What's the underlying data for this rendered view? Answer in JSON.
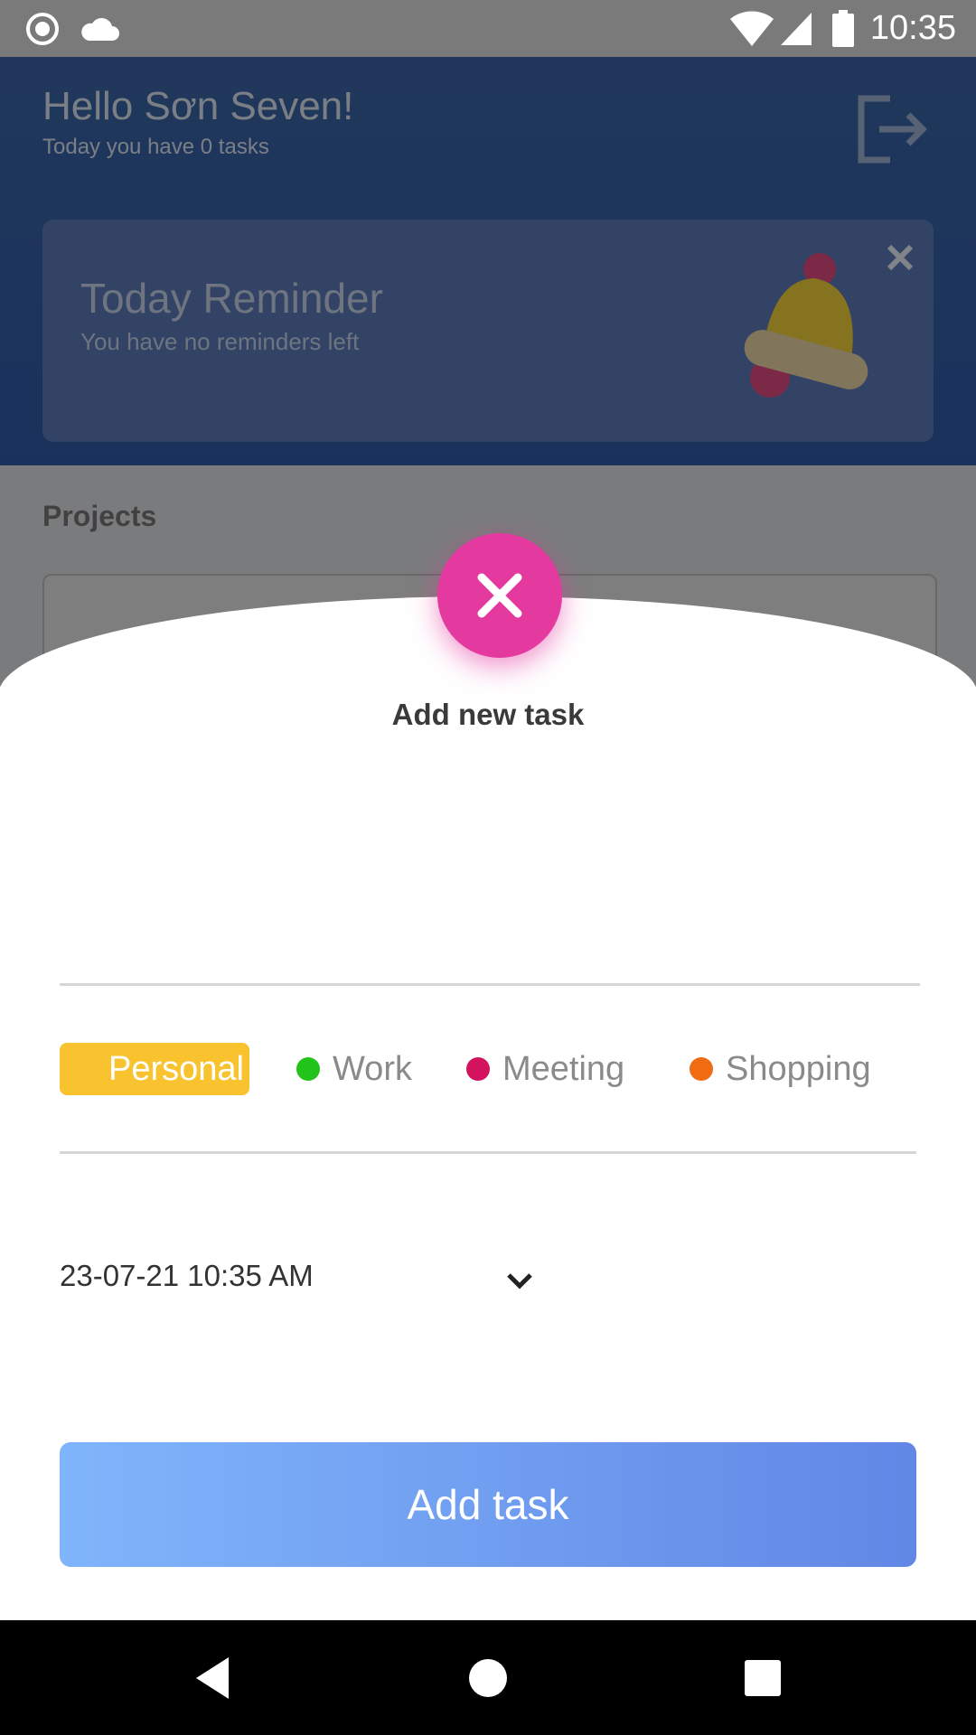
{
  "status_bar": {
    "time": "10:35",
    "icons": [
      "record-icon",
      "cloud-icon",
      "wifi-icon",
      "signal-icon",
      "battery-icon"
    ]
  },
  "background_app": {
    "greeting": "Hello Sơn Seven!",
    "task_count": "Today you have 0 tasks",
    "reminder": {
      "title": "Today Reminder",
      "subtitle": "You have no reminders left"
    },
    "projects_title": "Projects"
  },
  "sheet": {
    "title": "Add new task",
    "task_input": {
      "value": "",
      "placeholder": ""
    },
    "categories": [
      {
        "label": "Personal",
        "color": "#f9c22f",
        "selected": true
      },
      {
        "label": "Work",
        "color": "#22c41c",
        "selected": false
      },
      {
        "label": "Meeting",
        "color": "#d4135f",
        "selected": false
      },
      {
        "label": "Shopping",
        "color": "#ef6c12",
        "selected": false
      }
    ],
    "date_value": "23-07-21 10:35 AM",
    "add_button": "Add task"
  },
  "colors": {
    "accent_pink": "#e43aa0",
    "button_gradient_start": "#7fb5fb",
    "button_gradient_end": "#6287e6"
  }
}
